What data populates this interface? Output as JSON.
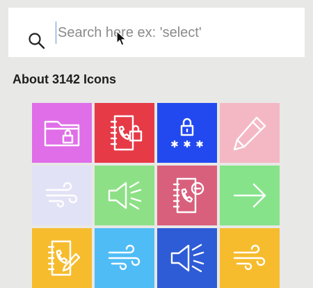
{
  "search": {
    "placeholder": "Search here ex: 'select'",
    "value": ""
  },
  "results": {
    "label": "About 3142 Icons"
  },
  "tiles": [
    {
      "icon": "folder-lock-icon",
      "color": "#e06ee8"
    },
    {
      "icon": "contact-book-lock-icon",
      "color": "#e63a47"
    },
    {
      "icon": "password-lock-icon",
      "color": "#2249f0"
    },
    {
      "icon": "pencil-icon",
      "color": "#f4b8c4"
    },
    {
      "icon": "wind-icon",
      "color": "#e2e2f6"
    },
    {
      "icon": "speaker-volume-icon",
      "color": "#8ee086"
    },
    {
      "icon": "contact-book-remove-icon",
      "color": "#d9607c"
    },
    {
      "icon": "arrow-right-icon",
      "color": "#86e38a"
    },
    {
      "icon": "contact-book-edit-icon",
      "color": "#f6bc2e"
    },
    {
      "icon": "wind-icon",
      "color": "#4fbcf6"
    },
    {
      "icon": "speaker-volume-icon",
      "color": "#2e5cd6"
    },
    {
      "icon": "wind-icon",
      "color": "#f6bc2e"
    }
  ]
}
